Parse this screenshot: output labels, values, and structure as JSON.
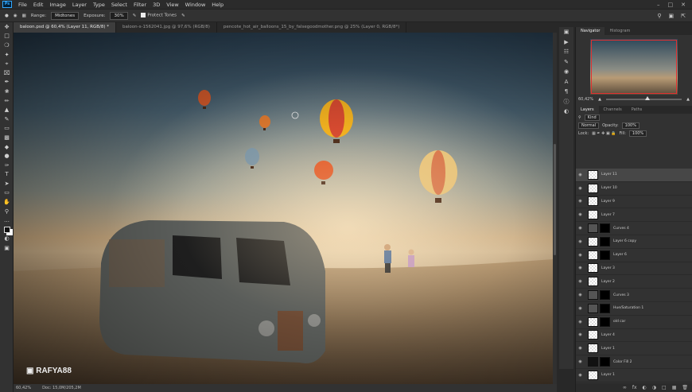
{
  "menu": [
    "File",
    "Edit",
    "Image",
    "Layer",
    "Type",
    "Select",
    "Filter",
    "3D",
    "View",
    "Window",
    "Help"
  ],
  "app_logo": "Ps",
  "options": {
    "range_label": "Range:",
    "range_value": "Midtones",
    "exposure_label": "Exposure:",
    "exposure_value": "30%",
    "protect_label": "Protect Tones"
  },
  "tabs": [
    "baloon.psd @ 60,4% (Layer 11, RGB/8) *",
    "baloon-s-1562041.jpg @ 97,6% (RGB/8)",
    "pencote_hot_air_balloons_15_by_falsegoodmother.png @ 25% (Layer 0, RGB/8*)"
  ],
  "watermark": "RAFYA88",
  "status": {
    "zoom": "60,42%",
    "doc": "Doc: 15,0M/205,2M"
  },
  "navigator": {
    "tabs": [
      "Navigator",
      "Histogram"
    ],
    "zoom": "60,42%"
  },
  "layers_panel": {
    "tabs": [
      "Layers",
      "Channels",
      "Paths"
    ],
    "kind": "Kind",
    "blend": "Normal",
    "opacity_label": "Opacity:",
    "opacity": "100%",
    "lock_label": "Lock:",
    "fill_label": "Fill:",
    "fill": "100%",
    "layers": [
      {
        "name": "Layer 11",
        "thumb": "trans",
        "active": true
      },
      {
        "name": "Layer 10",
        "thumb": "trans"
      },
      {
        "name": "Layer 9",
        "thumb": "trans"
      },
      {
        "name": "Layer 7",
        "thumb": "trans"
      },
      {
        "name": "Curves 4",
        "thumb": "adj",
        "mask": true
      },
      {
        "name": "Layer 6 copy",
        "thumb": "trans",
        "mask": true
      },
      {
        "name": "Layer 6",
        "thumb": "trans",
        "mask": true
      },
      {
        "name": "Layer 3",
        "thumb": "trans"
      },
      {
        "name": "Layer 2",
        "thumb": "trans"
      },
      {
        "name": "Curves 3",
        "thumb": "adj",
        "mask": true
      },
      {
        "name": "Hue/Saturation 1",
        "thumb": "adj",
        "mask": true
      },
      {
        "name": "old car",
        "thumb": "trans",
        "mask": true
      },
      {
        "name": "Layer 4",
        "thumb": "trans"
      },
      {
        "name": "Layer 1",
        "thumb": "trans"
      },
      {
        "name": "Color Fill 2",
        "thumb": "black",
        "mask": true
      },
      {
        "name": "Layer 1",
        "thumb": "trans"
      }
    ]
  },
  "colors": {
    "accent": "#31a8ff",
    "nav_rect": "#e03030"
  }
}
